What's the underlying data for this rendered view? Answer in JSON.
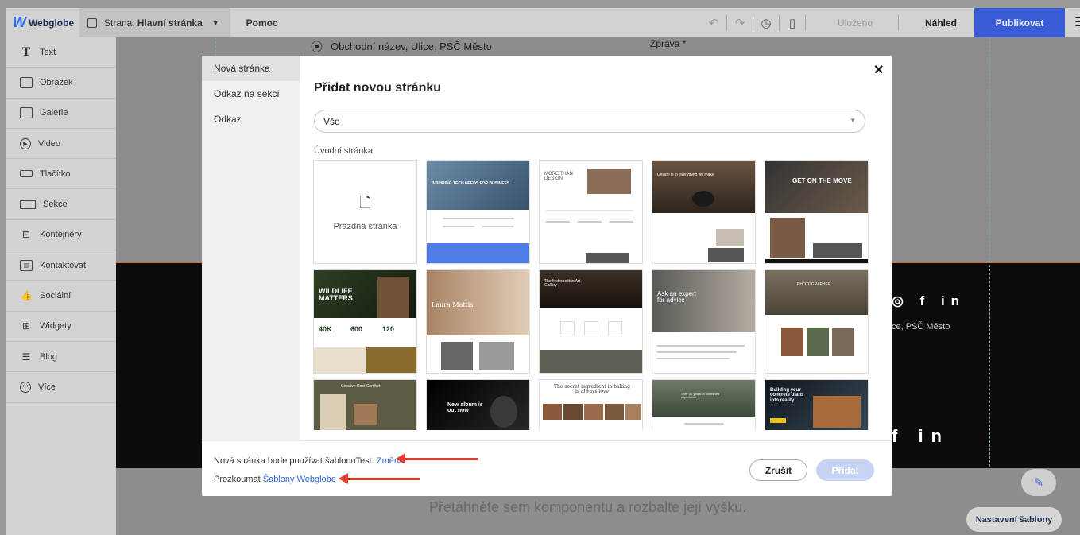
{
  "topbar": {
    "logo": "Webglobe",
    "page_prefix": "Strana:",
    "page_name": "Hlavní stránka",
    "help": "Pomoc",
    "saved": "Uloženo",
    "preview": "Náhled",
    "publish": "Publikovat"
  },
  "sidebar": {
    "items": [
      {
        "label": "Text",
        "icon": "text-icon"
      },
      {
        "label": "Obrázek",
        "icon": "image-icon"
      },
      {
        "label": "Galerie",
        "icon": "gallery-icon"
      },
      {
        "label": "Video",
        "icon": "video-icon"
      },
      {
        "label": "Tlačítko",
        "icon": "button-icon"
      },
      {
        "label": "Sekce",
        "icon": "section-icon"
      },
      {
        "label": "Kontejnery",
        "icon": "containers-icon"
      },
      {
        "label": "Kontaktovat",
        "icon": "contact-icon"
      },
      {
        "label": "Sociální",
        "icon": "social-icon"
      },
      {
        "label": "Widgety",
        "icon": "widgets-icon"
      },
      {
        "label": "Blog",
        "icon": "blog-icon"
      },
      {
        "label": "Více",
        "icon": "more-icon"
      }
    ]
  },
  "background": {
    "address": "Obchodní název, Ulice, PSČ Město",
    "message_label": "Zpráva *",
    "address_short": "ce, PSČ Město",
    "drop_hint": "Přetáhněte sem komponentu a rozbalte její výšku.",
    "template_settings": "Nastavení šablony"
  },
  "modal": {
    "nav": [
      "Nová stránka",
      "Odkaz na sekcí",
      "Odkaz"
    ],
    "title": "Přidat novou stránku",
    "filter_value": "Vše",
    "section_label": "Úvodní stránka",
    "blank_label": "Prázdná stránka",
    "templates": [
      {
        "title": "INSPIRING TECH NEEDS FOR BUSINESS",
        "theme": "#5a7fa6"
      },
      {
        "title": "MORE THAN DESIGN",
        "theme": "#ffffff"
      },
      {
        "title": "Design is in everything we make",
        "theme": "#5b4a3a"
      },
      {
        "title": "GET ON THE MOVE",
        "theme": "#3a3a3a"
      },
      {
        "title": "WILDLIFE MATTERS",
        "theme": "#2e3b22"
      },
      {
        "title": "Laura Mattis",
        "theme": "#b89478"
      },
      {
        "title": "The Metropolitan Art Gallery",
        "theme": "#3a2e22"
      },
      {
        "title": "Ask an expert for advice",
        "theme": "#6d6a66"
      },
      {
        "title": "PHOTOGRAPHER",
        "theme": "#8a8070"
      },
      {
        "title": "Creative Rest Comfort",
        "theme": "#6c6a4e"
      },
      {
        "title": "New album is out now",
        "theme": "#111111"
      },
      {
        "title": "The secret ingredient in baking is always love",
        "theme": "#ffffff"
      },
      {
        "title": "Over 30 years of combined experience",
        "theme": "#56644f"
      },
      {
        "title": "Building your concrete plans into reality",
        "theme": "#1c2430"
      }
    ],
    "template_stats": [
      "40K",
      "600",
      "120"
    ],
    "footer_note": "Nová stránka bude používat šablonuTest.",
    "footer_change": "Změna",
    "footer_explore": "Prozkoumat",
    "footer_explore_link": "Šablony Webglobe",
    "cancel": "Zrušit",
    "add": "Přidat"
  }
}
